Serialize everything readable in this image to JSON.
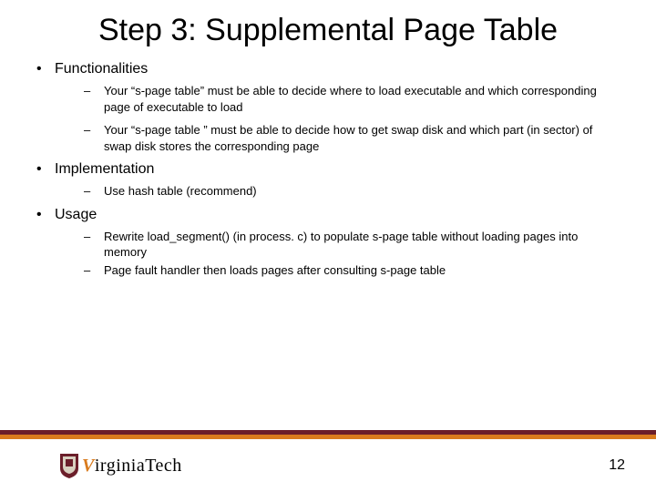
{
  "title": "Step 3: Supplemental Page Table",
  "sections": [
    {
      "label": "Functionalities",
      "items": [
        "Your “s-page table” must be able to decide where to load executable and which corresponding page of executable to load",
        "Your “s-page table ” must be able to decide how to get swap disk and which part (in sector) of swap disk stores the corresponding page"
      ]
    },
    {
      "label": "Implementation",
      "items": [
        "Use hash table (recommend)"
      ]
    },
    {
      "label": "Usage",
      "items": [
        "Rewrite load_segment() (in process. c) to populate s-page table without loading pages into memory",
        "Page fault handler then loads pages after consulting s-page table"
      ]
    }
  ],
  "logo": {
    "v": "V",
    "rest": "irginiaTech"
  },
  "page_number": "12"
}
